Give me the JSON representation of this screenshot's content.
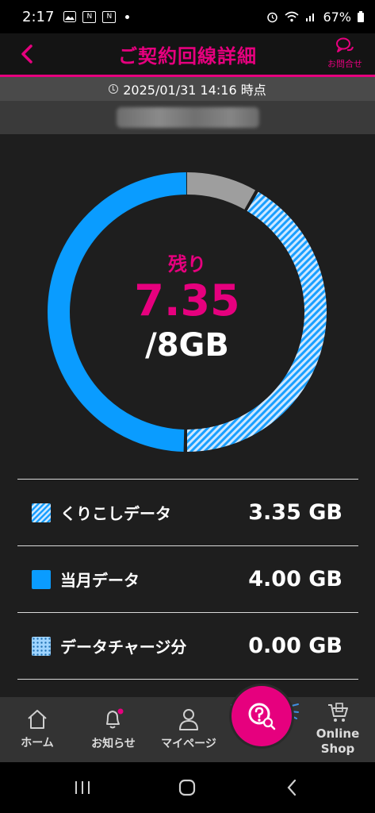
{
  "status_bar": {
    "time": "2:17",
    "battery": "67%"
  },
  "header": {
    "title": "ご契約回線詳細",
    "inquiry_label": "お問合せ"
  },
  "timestamp": "2025/01/31 14:16 時点",
  "usage": {
    "remaining_label": "残り",
    "remaining_value": "7.35",
    "total_label": "/8GB",
    "remaining_gb": 7.35,
    "total_gb": 8,
    "rollover_gb": 3.35,
    "current_month_gb": 4.0,
    "charge_gb": 0.0
  },
  "breakdown": [
    {
      "label": "くりこしデータ",
      "value": "3.35 GB",
      "pattern": "hatched"
    },
    {
      "label": "当月データ",
      "value": "4.00 GB",
      "pattern": "solid"
    },
    {
      "label": "データチャージ分",
      "value": "0.00 GB",
      "pattern": "dotted"
    }
  ],
  "colors": {
    "accent": "#e6007e",
    "data_blue": "#0a9cff",
    "used_gray": "#9e9e9e",
    "background": "#1e1e1e"
  },
  "bottom_nav": [
    {
      "label": "ホーム",
      "icon": "home-icon"
    },
    {
      "label": "お知らせ",
      "icon": "bell-icon"
    },
    {
      "label": "マイページ",
      "icon": "person-icon"
    },
    {
      "label": "",
      "icon": "help-search-icon"
    },
    {
      "label": "Online Shop",
      "icon": "shopping-cart-icon"
    }
  ]
}
